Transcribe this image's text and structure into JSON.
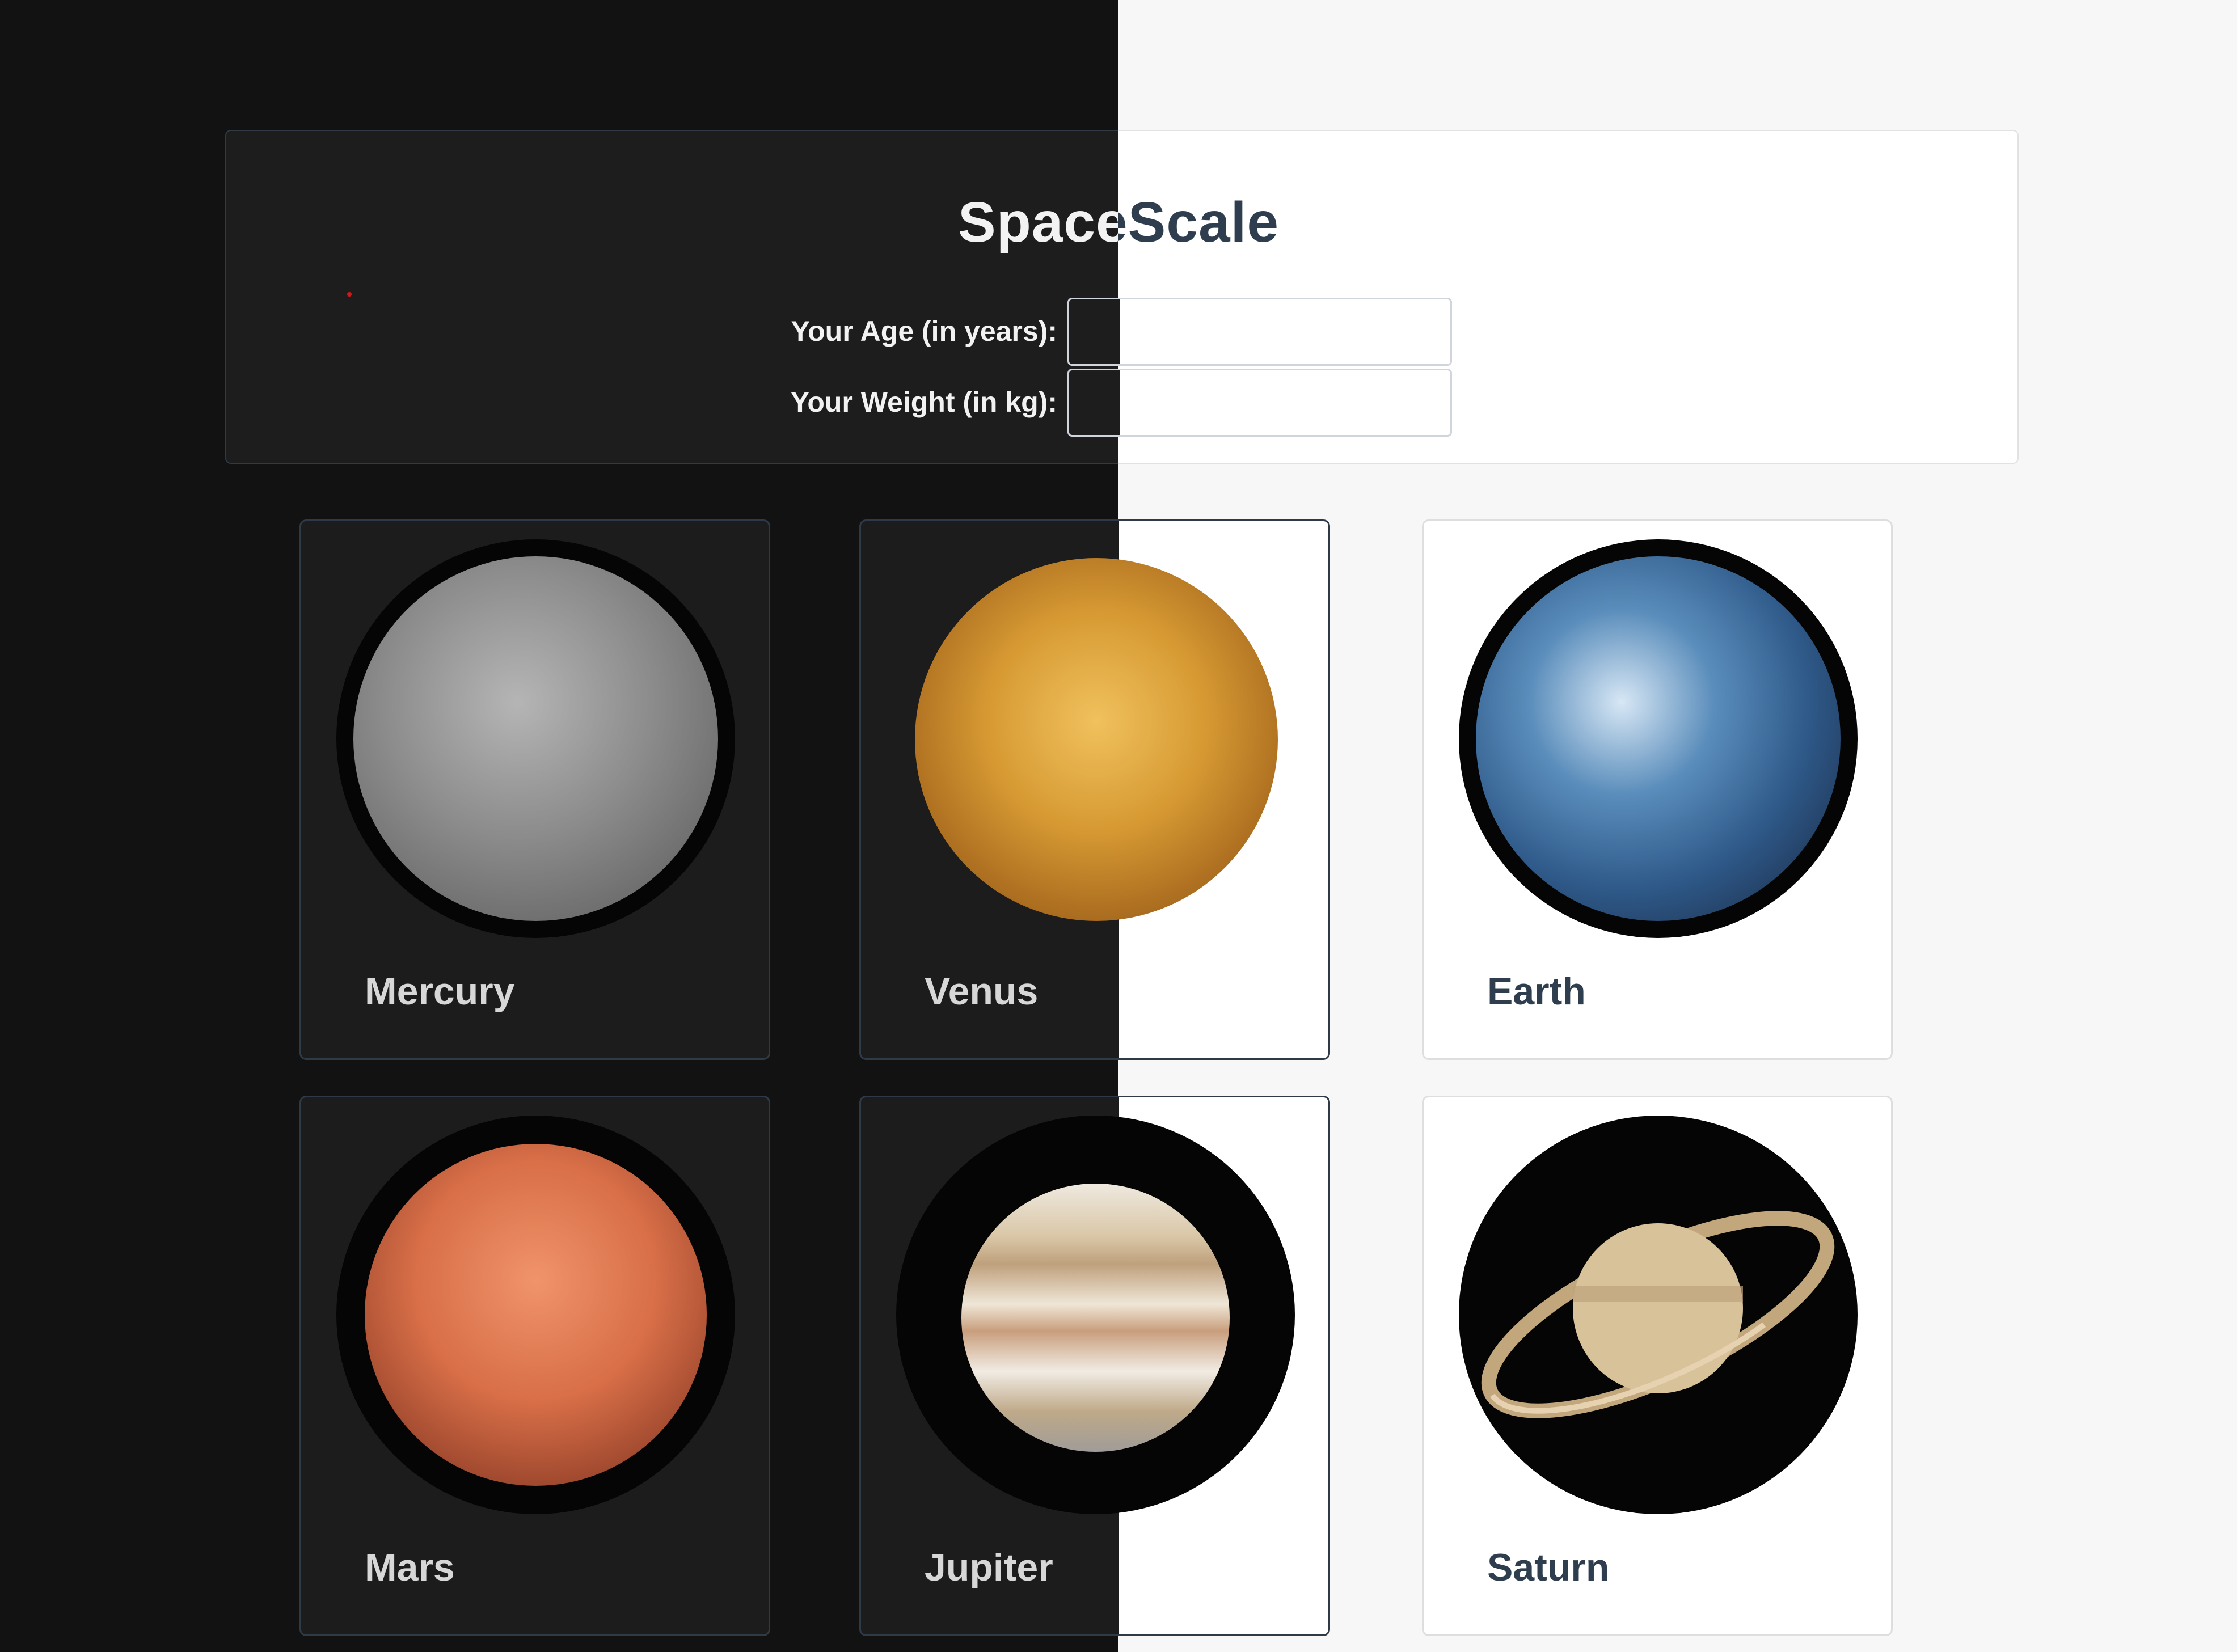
{
  "header": {
    "title": "SpaceScale",
    "age_label": "Your Age (in years):",
    "weight_label": "Your Weight (in kg):",
    "age_value": "",
    "weight_value": ""
  },
  "planets": [
    {
      "name": "Mercury",
      "icon": "mercury-icon",
      "color": "#8c8c8c"
    },
    {
      "name": "Venus",
      "icon": "venus-icon",
      "color": "#c98a2a"
    },
    {
      "name": "Earth",
      "icon": "earth-icon",
      "color": "#2f5a8a"
    },
    {
      "name": "Mars",
      "icon": "mars-icon",
      "color": "#d86f48"
    },
    {
      "name": "Jupiter",
      "icon": "jupiter-icon",
      "color": "#d9c6a6"
    },
    {
      "name": "Saturn",
      "icon": "saturn-icon",
      "color": "#d8c29a"
    }
  ],
  "theme": {
    "dark_bg": "#121213",
    "light_bg": "#f7f7f7",
    "text_dark": "#2e3e4e"
  }
}
